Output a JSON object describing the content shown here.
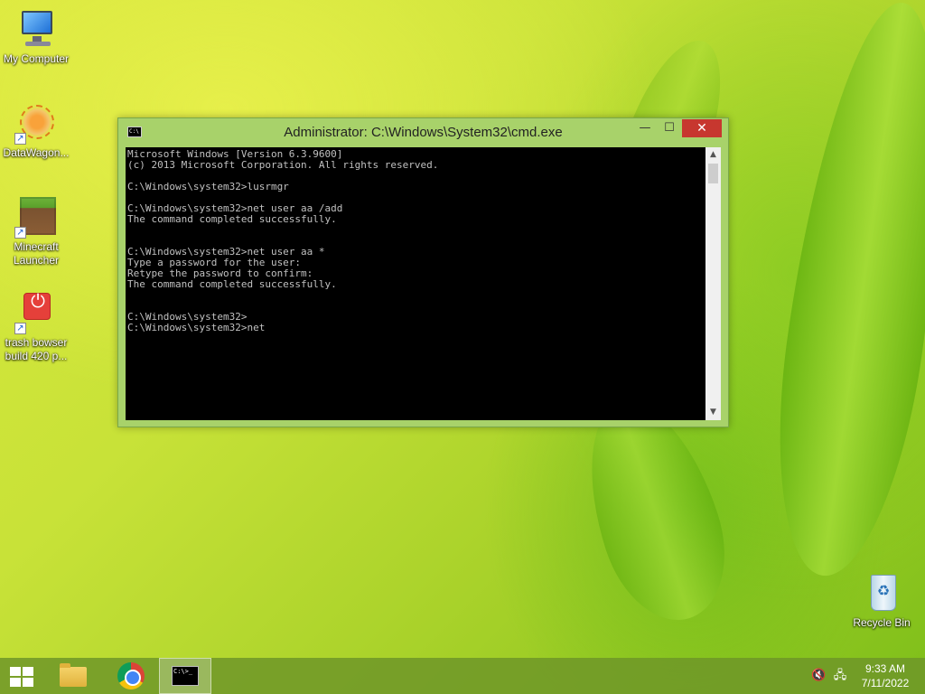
{
  "desktop": {
    "icons": [
      {
        "label": "My Computer",
        "icon": "computer-icon"
      },
      {
        "label": "DataWagon...",
        "icon": "datawagon-icon"
      },
      {
        "label": "Minecraft\nLauncher",
        "icon": "minecraft-icon"
      },
      {
        "label": "trash bowser\nbuild 420 p...",
        "icon": "trash-bowser-icon"
      },
      {
        "label": "Recycle Bin",
        "icon": "recycle-bin-icon"
      }
    ]
  },
  "window": {
    "title": "Administrator: C:\\Windows\\System32\\cmd.exe",
    "icon_glyph": "C:\\",
    "minimize": "—",
    "maximize": "☐",
    "close": "✕",
    "console_lines": [
      "Microsoft Windows [Version 6.3.9600]",
      "(c) 2013 Microsoft Corporation. All rights reserved.",
      "",
      "C:\\Windows\\system32>lusrmgr",
      "",
      "C:\\Windows\\system32>net user aa /add",
      "The command completed successfully.",
      "",
      "",
      "C:\\Windows\\system32>net user aa *",
      "Type a password for the user:",
      "Retype the password to confirm:",
      "The command completed successfully.",
      "",
      "",
      "C:\\Windows\\system32>",
      "C:\\Windows\\system32>net"
    ],
    "scroll_up": "▲",
    "scroll_down": "▼"
  },
  "taskbar": {
    "cmd_glyph": "C:\\>_",
    "tray": {
      "volume_icon": "🔇",
      "network_icon": "🖧"
    },
    "clock": {
      "time": "9:33 AM",
      "date": "7/11/2022"
    }
  }
}
